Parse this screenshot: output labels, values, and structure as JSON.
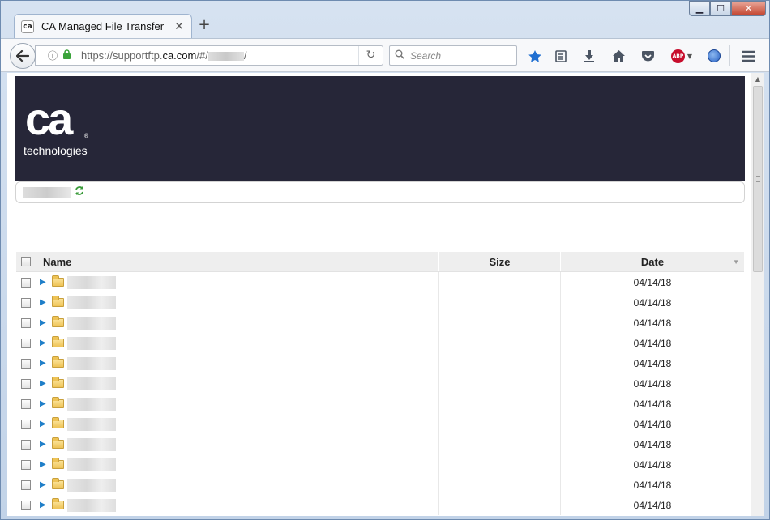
{
  "browser": {
    "tab_title": "CA Managed File Transfer",
    "tab_favicon_text": "ca",
    "new_tab_label": "+",
    "close_tab_label": "✕",
    "url_prefix": "https://supportftp.",
    "url_domain": "ca.com",
    "url_path": "/#/",
    "url_suffix": "/",
    "search_placeholder": "Search",
    "window_minimize": "▁",
    "window_maximize": "☐",
    "window_close": "✕"
  },
  "header": {
    "logo_mark": "ca",
    "logo_registered": "®",
    "logo_text": "technologies",
    "brand_bg": "#262638"
  },
  "table": {
    "columns": {
      "name": "Name",
      "size": "Size",
      "date": "Date"
    },
    "sort_indicator": "▼",
    "rows": [
      {
        "date": "04/14/18",
        "size": ""
      },
      {
        "date": "04/14/18",
        "size": ""
      },
      {
        "date": "04/14/18",
        "size": ""
      },
      {
        "date": "04/14/18",
        "size": ""
      },
      {
        "date": "04/14/18",
        "size": ""
      },
      {
        "date": "04/14/18",
        "size": ""
      },
      {
        "date": "04/14/18",
        "size": ""
      },
      {
        "date": "04/14/18",
        "size": ""
      },
      {
        "date": "04/14/18",
        "size": ""
      },
      {
        "date": "04/14/18",
        "size": ""
      },
      {
        "date": "04/14/18",
        "size": ""
      },
      {
        "date": "04/14/18",
        "size": ""
      }
    ]
  },
  "icons": {
    "back": "back-arrow-icon",
    "info": "info-icon",
    "lock": "lock-icon",
    "reload": "reload-icon",
    "search": "search-icon",
    "bookmark_star": "star-icon",
    "reading_list": "clipboard-icon",
    "downloads": "download-icon",
    "home": "home-icon",
    "pocket": "pocket-icon",
    "adblock": "abp-icon",
    "globe": "globe-icon",
    "menu": "hamburger-menu-icon",
    "refresh_folder": "refresh-icon",
    "folder": "folder-icon",
    "expand": "expand-arrow-icon"
  }
}
